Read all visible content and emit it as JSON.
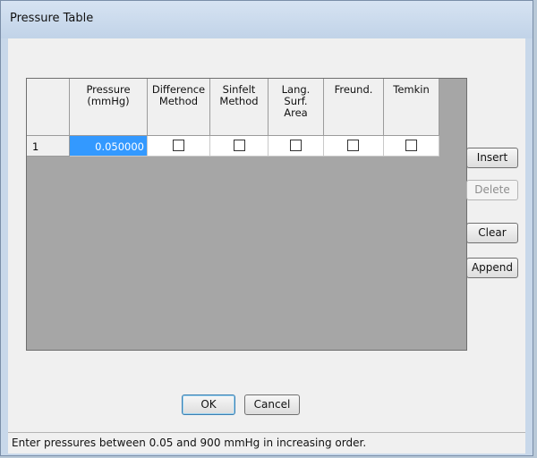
{
  "dialog": {
    "title": "Pressure Table"
  },
  "table": {
    "columns": [
      "Pressure\n(mmHg)",
      "Difference\nMethod",
      "Sinfelt\nMethod",
      "Lang.\nSurf.\nArea",
      "Freund.",
      "Temkin"
    ],
    "rows": [
      {
        "index": "1",
        "pressure": "0.050000",
        "difference_method": false,
        "sinfelt_method": false,
        "lang_surf_area": false,
        "freund": false,
        "temkin": false
      }
    ]
  },
  "side_buttons": {
    "insert": "Insert",
    "delete": "Delete",
    "clear": "Clear",
    "append": "Append"
  },
  "footer_buttons": {
    "ok": "OK",
    "cancel": "Cancel"
  },
  "status": {
    "text": "Enter pressures between 0.05 and 900 mmHg in increasing order."
  }
}
